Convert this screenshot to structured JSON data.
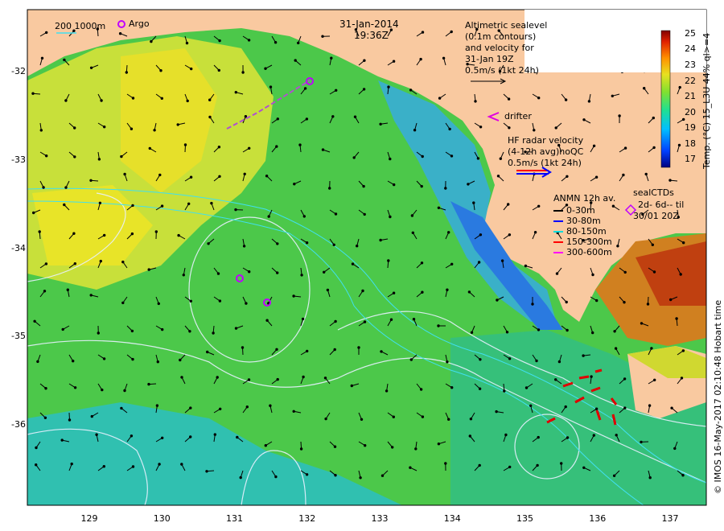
{
  "header": {
    "date": "31-Jan-2014",
    "time": "19:36Z",
    "scale_label": "200  1000m",
    "argo_label": "Argo"
  },
  "altimetry": {
    "lines": [
      "Altimetric sealevel",
      "(0.1m contours)",
      "and velocity for",
      "31-Jan 19Z",
      "0.5m/s (1kt 24h)"
    ]
  },
  "drifter": {
    "label": "drifter"
  },
  "hf_radar": {
    "lines": [
      "HF radar velocity",
      "(4-12h avg)noQC",
      "0.5m/s (1kt 24h)"
    ]
  },
  "anmn": {
    "title": "ANMN 12h av.",
    "items": [
      {
        "label": "0-30m",
        "color": "#000000"
      },
      {
        "label": "30-80m",
        "color": "#0000ff"
      },
      {
        "label": "80-150m",
        "color": "#00dddd"
      },
      {
        "label": "150-300m",
        "color": "#ff0000"
      },
      {
        "label": "300-600m",
        "color": "#ff00ff"
      }
    ]
  },
  "seal_ctds": {
    "title": "sealCTDs",
    "line1": "2d-  6d-- til",
    "line2": "30/01 20Z"
  },
  "colorbar": {
    "title": "Temp. (°C) 15_L3U 44% ql>=4",
    "ticks": [
      "25",
      "24",
      "23",
      "22",
      "21",
      "20",
      "19",
      "18",
      "17"
    ],
    "min": 16.5,
    "max": 25.2
  },
  "axes": {
    "y_ticks": [
      "-32",
      "-33",
      "-34",
      "-35",
      "-36"
    ],
    "x_ticks": [
      "129",
      "130",
      "131",
      "132",
      "133",
      "134",
      "135",
      "136",
      "137"
    ]
  },
  "credit": "© IMOS 16-May-2017 02:10:48 Hobart time"
}
